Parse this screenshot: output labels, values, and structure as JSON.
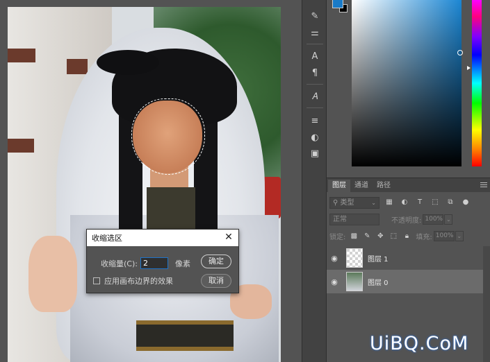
{
  "dialog": {
    "title": "收缩选区",
    "contract_label": "收缩量(C):",
    "contract_value": "2",
    "unit": "像素",
    "apply_canvas_label": "应用画布边界的效果",
    "ok_label": "确定",
    "cancel_label": "取消",
    "close_glyph": "✕"
  },
  "colors": {
    "foreground": "#1a7bc8",
    "background": "#000000"
  },
  "layers_panel": {
    "tabs": [
      "图层",
      "通道",
      "路径"
    ],
    "kind_label": "类型",
    "blend_mode": "正常",
    "opacity_label": "不透明度:",
    "opacity_value": "100%",
    "lock_label": "锁定:",
    "fill_label": "填充:",
    "fill_value": "100%",
    "layers": [
      {
        "name": "图层 1"
      },
      {
        "name": "图层 0"
      }
    ]
  },
  "watermark": "UiBQ.CoM"
}
